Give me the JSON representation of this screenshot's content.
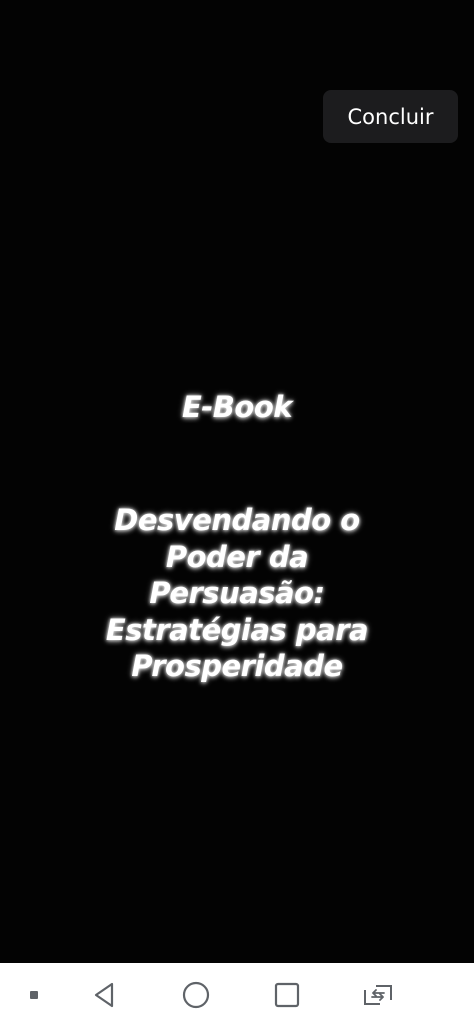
{
  "toolbar": {
    "done_label": "Concluir"
  },
  "story": {
    "heading": "E-Book",
    "title_lines": [
      "Desvendando o",
      "Poder da",
      "Persuasão:",
      "Estratégias para",
      "Prosperidade"
    ]
  },
  "navigation_bar": {
    "buttons": [
      {
        "icon": "menu-dot-icon"
      },
      {
        "icon": "back-triangle-icon"
      },
      {
        "icon": "home-circle-icon"
      },
      {
        "icon": "recents-square-icon"
      },
      {
        "icon": "rotate-switch-icon"
      }
    ]
  },
  "colors": {
    "background": "#030303",
    "text": "#ffffff",
    "button_background": "#1c1c1e",
    "nav_background": "#ffffff",
    "nav_icon": "#5f6368"
  }
}
